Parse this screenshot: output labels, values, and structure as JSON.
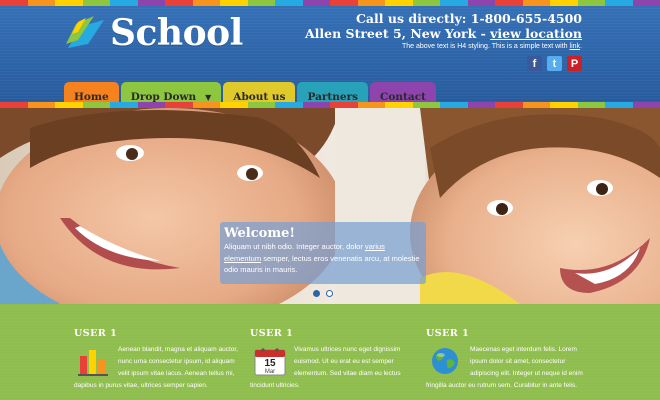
{
  "brand": {
    "name": "School"
  },
  "contact": {
    "line1": "Call us directly: 1-800-655-4500",
    "line2_prefix": "Allen Street 5, New York - ",
    "line2_link": "view location",
    "note_prefix": "The above text is H4 styling. This is a simple text with ",
    "note_link": "link",
    "note_suffix": "."
  },
  "social": {
    "facebook": "f",
    "twitter": "t",
    "pinterest": "P"
  },
  "colors": {
    "header": "#2c64a8",
    "band": "#8fbd4e",
    "stripe": [
      "#e8413a",
      "#f7941d",
      "#ffd200",
      "#8dc63f",
      "#27aae1",
      "#8e44ad",
      "#e8413a",
      "#f7941d",
      "#ffd200",
      "#8dc63f",
      "#27aae1",
      "#8e44ad",
      "#e8413a",
      "#f7941d",
      "#ffd200",
      "#8dc63f",
      "#27aae1",
      "#8e44ad",
      "#e8413a",
      "#f7941d",
      "#ffd200",
      "#8dc63f",
      "#27aae1",
      "#8e44ad"
    ]
  },
  "nav": [
    {
      "label": "Home",
      "color": "#f6821f"
    },
    {
      "label": "Drop Down",
      "color": "#8dc63f",
      "dropdown": true
    },
    {
      "label": "About us",
      "color": "#e0c92a"
    },
    {
      "label": "Partners",
      "color": "#27a2b8"
    },
    {
      "label": "Contact",
      "color": "#8e44ad"
    }
  ],
  "hero": {
    "caption_title": "Welcome!",
    "caption_text_1": "Aliquam ut nibh odio. Integer auctor, dolor ",
    "caption_link": "varius elementum",
    "caption_text_2": " semper, lectus eros venenatis arcu, at molestie odio mauris in mauris.",
    "slides": 2,
    "active_slide": 1
  },
  "features": [
    {
      "title": "USER 1",
      "icon": "bar-chart-icon",
      "text": "Aenean blandit, magna et aliquam auctor, nunc urna consectetur ipsum, id aliquam velit ipsum vitae lacus. Aenean tellus mi, dapibus in purus vitae, ultrices semper sapien."
    },
    {
      "title": "USER 1",
      "icon": "calendar-icon",
      "calendar_day": "15",
      "calendar_month": "Mar",
      "text": "Vivamus ultrices nunc eget dignissim euismod. Ut eu erat eu est semper elementum. Sed vitae diam eu lectus tincidunt ultricies."
    },
    {
      "title": "USER 1",
      "icon": "globe-icon",
      "text": "Maecenas eget interdum felis. Lorem ipsum dolor sit amet, consectetur adipiscing elit. Integer ut neque id enim fringilla auctor eu rutrum sem. Curabitur in ante felis."
    }
  ]
}
